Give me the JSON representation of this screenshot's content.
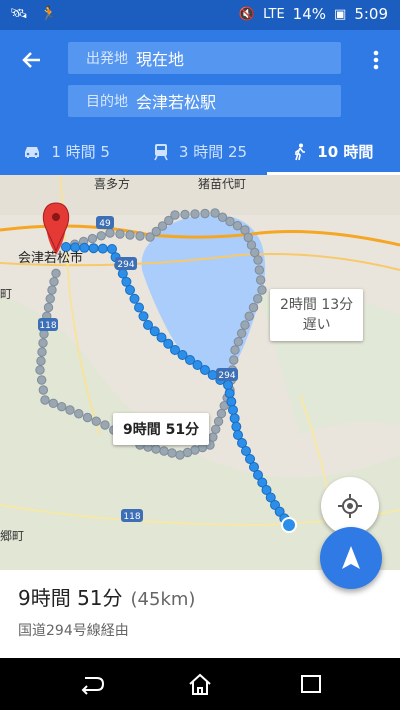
{
  "status": {
    "signal": "LTE",
    "battery": "14%",
    "time": "5:09"
  },
  "route": {
    "origin_label": "出発地",
    "origin_value": "現在地",
    "dest_label": "目的地",
    "dest_value": "会津若松駅"
  },
  "modes": [
    {
      "icon": "car-icon",
      "label": "1 時間 5"
    },
    {
      "icon": "train-icon",
      "label": "3 時間 25"
    },
    {
      "icon": "walk-icon",
      "label": "10 時間"
    }
  ],
  "map": {
    "place_top": "猪苗代町",
    "place_top_left": "喜多方",
    "city": "会津若松市",
    "place_left": "町",
    "place_bottom_left": "郷町",
    "route_shields": [
      "49",
      "294",
      "118",
      "294",
      "118"
    ],
    "alt_route_time": "2時間 13分",
    "alt_route_note": "遅い",
    "main_route_time": "9時間 51分"
  },
  "summary": {
    "duration": "9時間 51分",
    "distance": "(45km)",
    "via": "国道294号線経由"
  },
  "colors": {
    "primary": "#2f7ae5",
    "statusbar": "#1b5ebf",
    "route": "#2b8fea",
    "alt_route": "#9aa7b3",
    "lake": "#abcdfb"
  }
}
